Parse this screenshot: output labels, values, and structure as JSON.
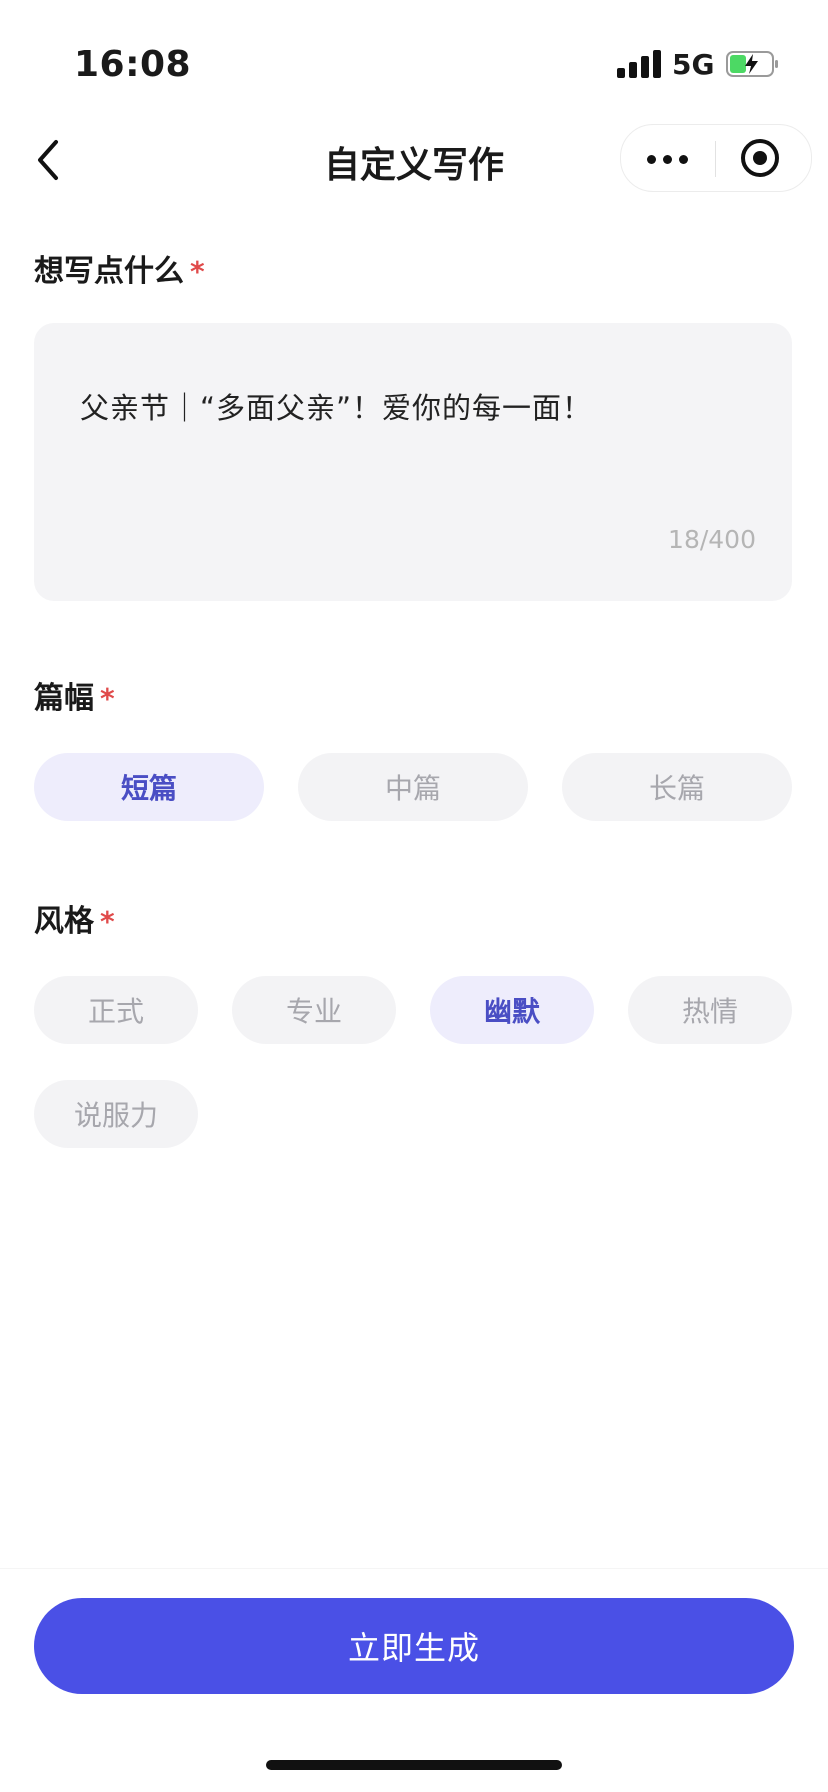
{
  "status_bar": {
    "time": "16:08",
    "network": "5G"
  },
  "nav": {
    "title": "自定义写作"
  },
  "prompt_section": {
    "label": "想写点什么",
    "required_mark": "*",
    "value": "父亲节｜“多面父亲”！爱你的每一面！",
    "counter": "18/400"
  },
  "length_section": {
    "label": "篇幅",
    "required_mark": "*",
    "options": [
      "短篇",
      "中篇",
      "长篇"
    ],
    "selected": "短篇"
  },
  "style_section": {
    "label": "风格",
    "required_mark": "*",
    "options": [
      "正式",
      "专业",
      "幽默",
      "热情",
      "说服力"
    ],
    "selected": "幽默"
  },
  "footer": {
    "generate_label": "立即生成"
  },
  "colors": {
    "accent": "#4a50e6",
    "selected_chip_bg": "#eeedfc",
    "required": "#e04a4a"
  }
}
